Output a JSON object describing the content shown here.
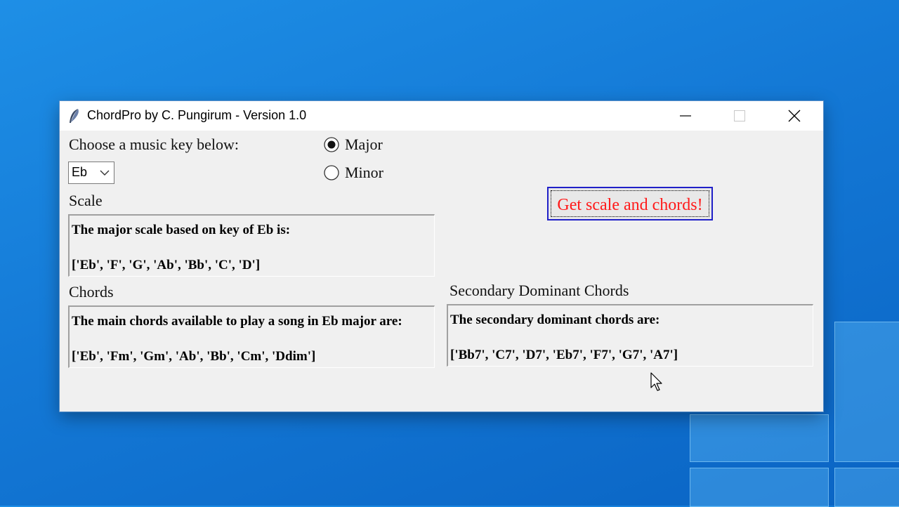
{
  "window": {
    "title": "ChordPro by C. Pungirum - Version 1.0",
    "icon": "feather-icon"
  },
  "key_selector": {
    "prompt": "Choose a music key below:",
    "selected": "Eb"
  },
  "mode": {
    "options": [
      {
        "label": "Major",
        "selected": true
      },
      {
        "label": "Minor",
        "selected": false
      }
    ]
  },
  "action_button": {
    "label": "Get scale and chords!",
    "text_color": "#ff1a1a",
    "border_color": "#2020c8"
  },
  "scale": {
    "heading": "Scale",
    "line1": "The major scale based on key of Eb is:",
    "line2": "['Eb', 'F', 'G', 'Ab', 'Bb', 'C', 'D']"
  },
  "chords": {
    "heading": "Chords",
    "line1": "The main chords available to play a song in Eb major are:",
    "line2": "['Eb', 'Fm', 'Gm', 'Ab', 'Bb', 'Cm', 'Ddim']"
  },
  "secondary": {
    "heading": "Secondary Dominant Chords",
    "line1": "The secondary dominant chords are:",
    "line2": "['Bb7', 'C7', 'D7', 'Eb7', 'F7', 'G7', 'A7']"
  }
}
